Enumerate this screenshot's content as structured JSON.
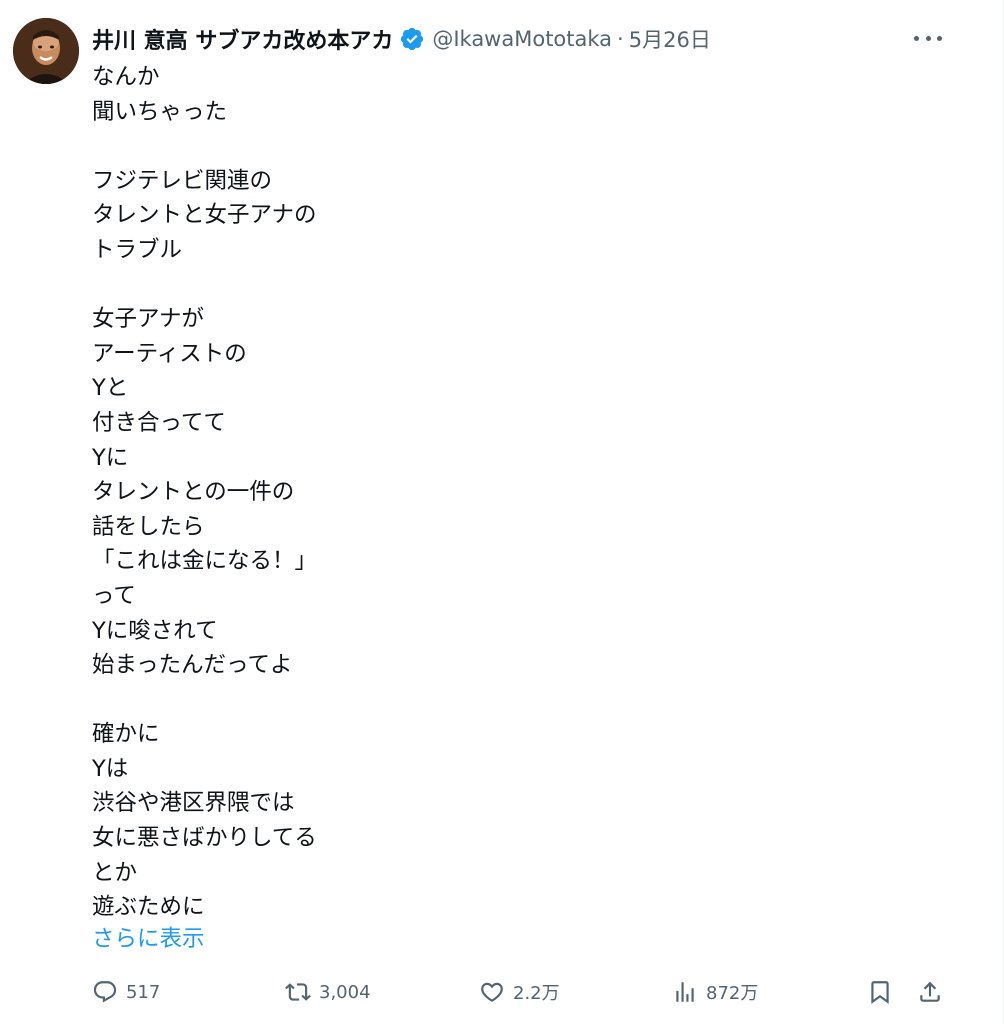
{
  "author": {
    "display_name": "井川 意高 サブアカ改め本アカ",
    "handle": "@IkawaMototaka",
    "separator": "·",
    "date": "5月26日"
  },
  "tweet": {
    "lines": [
      "なんか",
      "聞いちゃった",
      "",
      "フジテレビ関連の",
      "タレントと女子アナの",
      "トラブル",
      "",
      "女子アナが",
      "アーティストの",
      "Yと",
      "付き合ってて",
      "Yに",
      "タレントとの一件の",
      "話をしたら",
      "「これは金になる！」",
      "って",
      "Yに唆されて",
      "始まったんだってよ",
      "",
      "確かに",
      "Yは",
      "渋谷や港区界隈では",
      "女に悪さばかりしてる",
      "とか",
      "遊ぶために"
    ],
    "show_more": "さらに表示"
  },
  "actions": {
    "reply_count": "517",
    "retweet_count": "3,004",
    "like_count": "2.2万",
    "views_count": "872万"
  },
  "colors": {
    "accent": "#1d9bf0",
    "text": "#0f1419",
    "muted": "#536471"
  },
  "icons": [
    "verified-badge-icon",
    "more-icon",
    "reply-icon",
    "retweet-icon",
    "like-icon",
    "views-icon",
    "bookmark-icon",
    "share-icon"
  ]
}
